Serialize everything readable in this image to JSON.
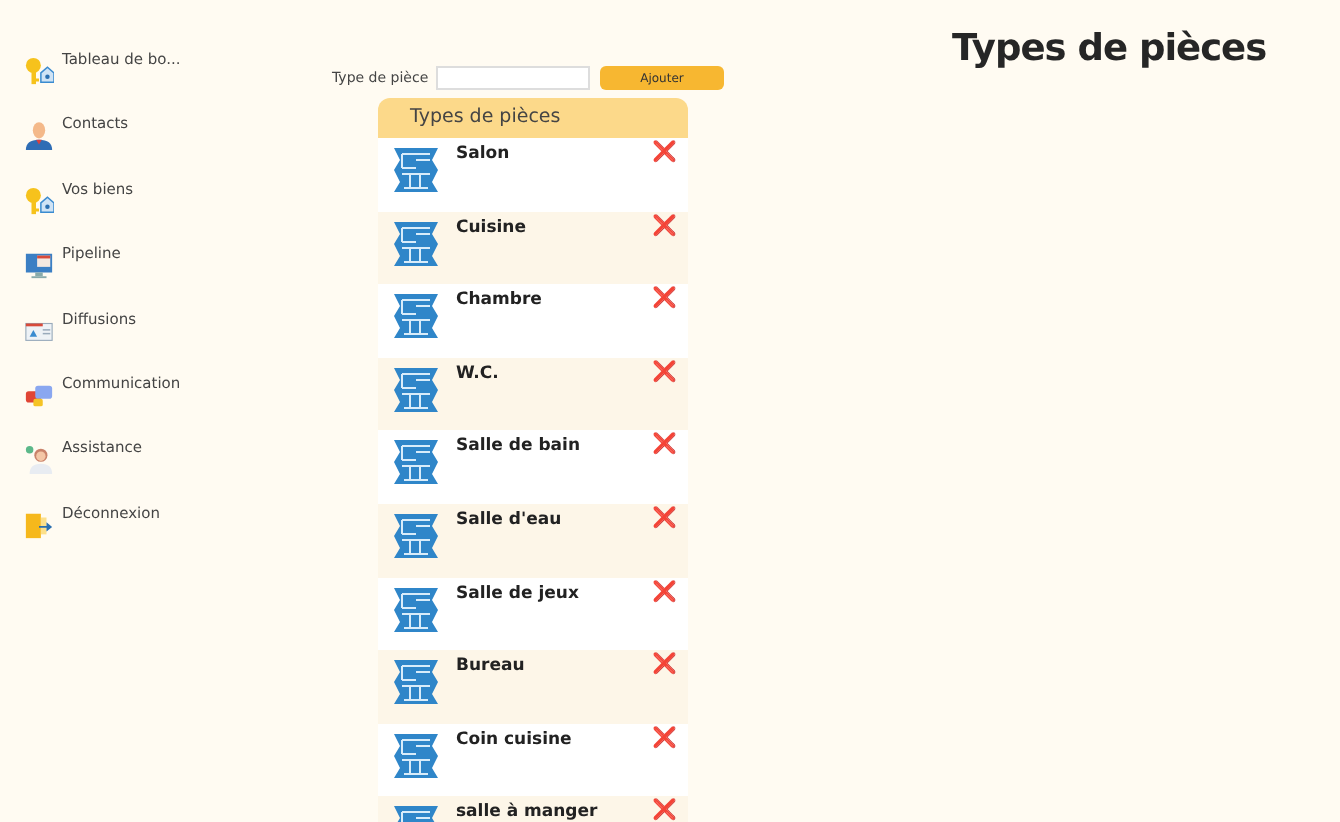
{
  "sidebar": {
    "items": [
      {
        "label": "Tableau de bo...",
        "kind": "key-house"
      },
      {
        "label": "Contacts",
        "kind": "person"
      },
      {
        "label": "Vos biens",
        "kind": "key-house"
      },
      {
        "label": "Pipeline",
        "kind": "monitor"
      },
      {
        "label": "Diffusions",
        "kind": "newspaper"
      },
      {
        "label": "Communication",
        "kind": "chat"
      },
      {
        "label": "Assistance",
        "kind": "agent"
      },
      {
        "label": "Déconnexion",
        "kind": "door"
      }
    ]
  },
  "form": {
    "label": "Type de pièce",
    "button": "Ajouter"
  },
  "list": {
    "header": "Types de pièces",
    "items": [
      {
        "name": "Salon",
        "delete": "❌"
      },
      {
        "name": "Cuisine",
        "delete": "❌"
      },
      {
        "name": "Chambre",
        "delete": "❌"
      },
      {
        "name": "W.C.",
        "delete": "❌"
      },
      {
        "name": "Salle de bain",
        "delete": "❌"
      },
      {
        "name": "Salle d'eau",
        "delete": "❌"
      },
      {
        "name": "Salle de jeux",
        "delete": "❌"
      },
      {
        "name": "Bureau",
        "delete": "❌"
      },
      {
        "name": "Coin cuisine",
        "delete": "❌"
      },
      {
        "name": "salle à manger",
        "delete": "❌"
      }
    ]
  },
  "page_title": "Types de pièces"
}
